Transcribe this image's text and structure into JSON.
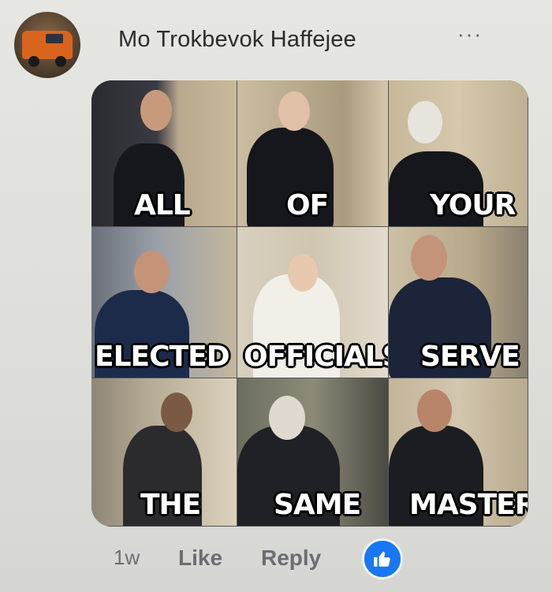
{
  "post": {
    "author_name": "Mo Trokbevok Haffejee",
    "more_options_label": "···"
  },
  "meme": {
    "captions": [
      "ALL",
      "OF",
      "YOUR",
      "ELECTED",
      "OFFICIALS",
      "SERVE",
      "THE",
      "SAME",
      "MASTER"
    ]
  },
  "comment_actions": {
    "timestamp": "1w",
    "like_label": "Like",
    "reply_label": "Reply",
    "reaction_icon": "thumbs-up-icon"
  },
  "colors": {
    "reaction_blue": "#1877f2",
    "text_gray": "#6c6d72",
    "author_text": "#2b2b30"
  }
}
